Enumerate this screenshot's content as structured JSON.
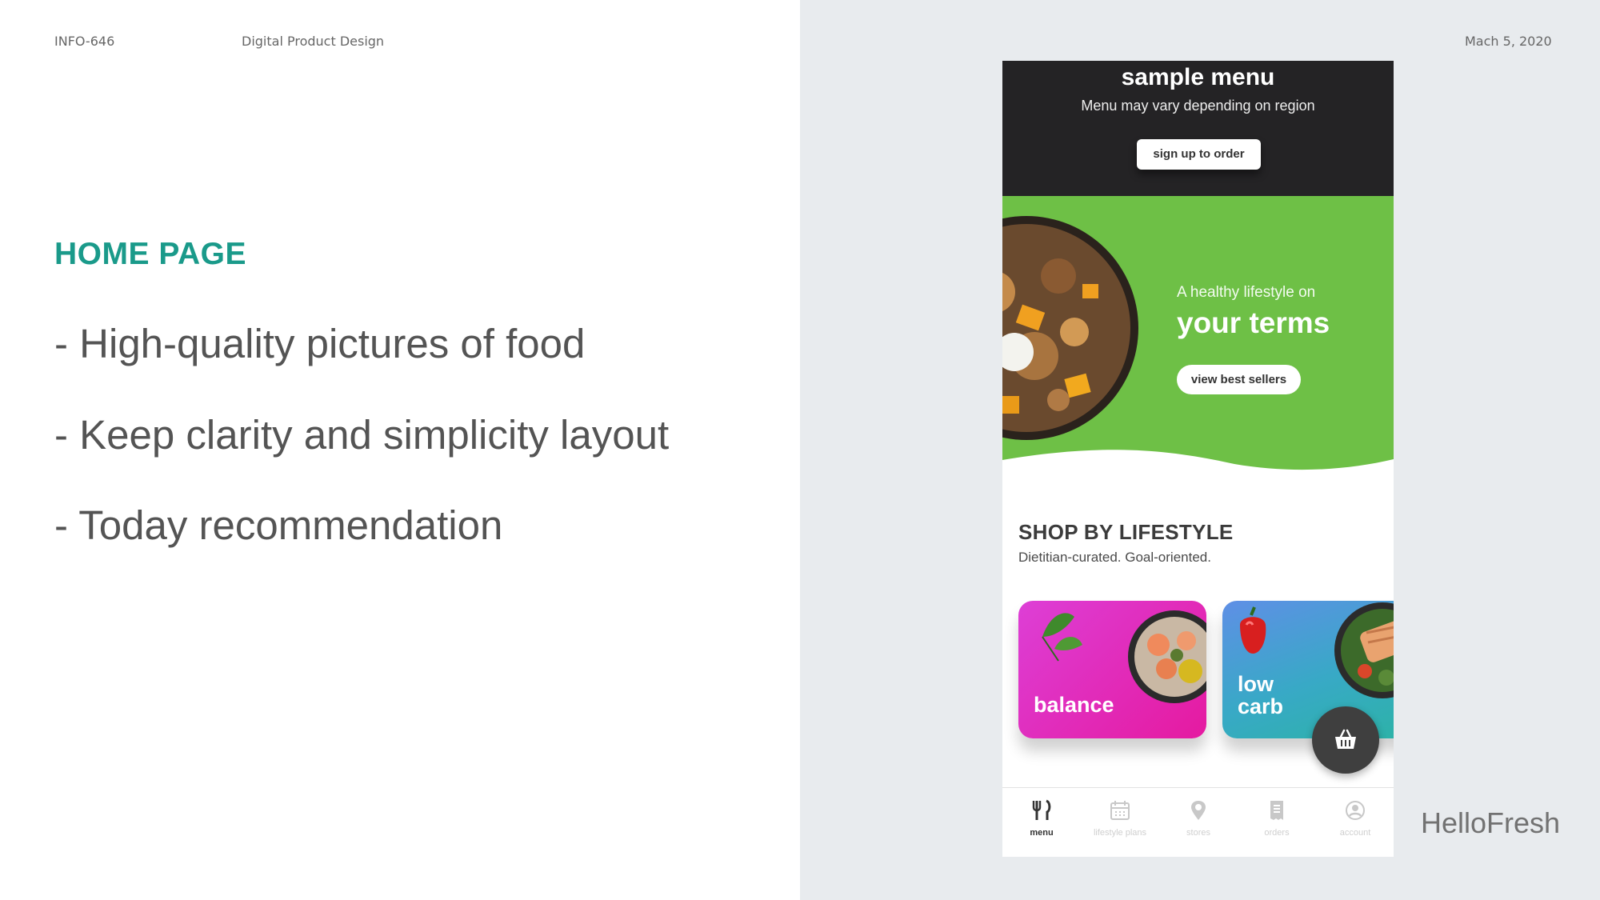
{
  "slide": {
    "course": "INFO-646",
    "subject": "Digital Product Design",
    "date": "Mach 5, 2020",
    "section_title": "HOME PAGE",
    "bullets": [
      "- High-quality pictures of food",
      "- Keep clarity and simplicity layout",
      "- Today recommendation"
    ],
    "brand": "HelloFresh"
  },
  "phone": {
    "header": {
      "title": "sample menu",
      "subtitle": "Menu may vary depending on region",
      "signup_label": "sign up to order"
    },
    "hero": {
      "tagline_small": "A healthy lifestyle on",
      "tagline_big": "your terms",
      "cta_label": "view best sellers"
    },
    "shop": {
      "title": "SHOP BY LIFESTYLE",
      "subtitle": "Dietitian-curated. Goal-oriented.",
      "cards": [
        {
          "label": "balance"
        },
        {
          "label_line1": "low",
          "label_line2": "carb"
        }
      ]
    },
    "tabs": [
      {
        "label": "menu",
        "icon": "fork-knife-icon",
        "active": true
      },
      {
        "label": "lifestyle plans",
        "icon": "calendar-icon",
        "active": false
      },
      {
        "label": "stores",
        "icon": "location-pin-icon",
        "active": false
      },
      {
        "label": "orders",
        "icon": "receipt-icon",
        "active": false
      },
      {
        "label": "account",
        "icon": "user-icon",
        "active": false
      }
    ]
  },
  "colors": {
    "accent_teal": "#1a9a8a",
    "hero_green": "#6ec046",
    "header_dark": "#242325",
    "balance_magenta": "#e22bc4",
    "lowcarb_blue": "#4a9fd4"
  }
}
